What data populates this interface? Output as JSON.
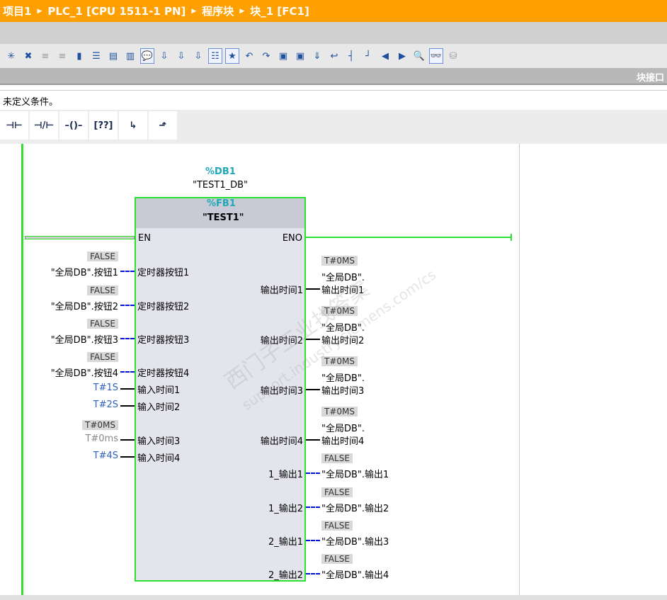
{
  "breadcrumb": [
    "项目1",
    "PLC_1 [CPU 1511-1 PN]",
    "程序块",
    "块_1 [FC1]"
  ],
  "toolbar_icons": [
    "insert-network-icon",
    "delete-network-icon",
    "insert-row-icon",
    "add-row-icon",
    "block-absolute-icon",
    "network-list-icon",
    "open-all-icon",
    "close-all-icon",
    "comment-icon",
    "favorites-download-icon",
    "instruction-download-icon",
    "network-download-icon",
    "list-icon",
    "favorites-icon",
    "go-to-error-icon",
    "next-error-icon",
    "monitor-icon",
    "monitor-block-icon",
    "compile-icon",
    "jump-icon",
    "branch-icon",
    "close-branch-icon",
    "previous-icon",
    "next-icon",
    "search-icon",
    "monitoring-on-icon",
    "database-icon"
  ],
  "interface_label": "块接口",
  "condition_text": "未定义条件。",
  "lad_buttons": [
    {
      "icon": "normally-open-contact-icon",
      "glyph": "⊣⊢"
    },
    {
      "icon": "normally-closed-contact-icon",
      "glyph": "⊣/⊢"
    },
    {
      "icon": "coil-icon",
      "glyph": "–()–"
    },
    {
      "icon": "empty-box-icon",
      "glyph": "[??]"
    },
    {
      "icon": "open-branch-icon",
      "glyph": "↳"
    },
    {
      "icon": "close-branch-icon",
      "glyph": "⬏"
    }
  ],
  "block": {
    "db_address": "%DB1",
    "db_name": "\"TEST1_DB\"",
    "fb_address": "%FB1",
    "fb_name": "\"TEST1\"",
    "en": "EN",
    "eno": "ENO"
  },
  "inputs": [
    {
      "pin": "定时器按钮1",
      "value": "\"全局DB\".按钮1",
      "status": "FALSE",
      "wire": "dash",
      "style": "black"
    },
    {
      "pin": "定时器按钮2",
      "value": "\"全局DB\".按钮2",
      "status": "FALSE",
      "wire": "dash",
      "style": "black"
    },
    {
      "pin": "定时器按钮3",
      "value": "\"全局DB\".按钮3",
      "status": "FALSE",
      "wire": "dash",
      "style": "black"
    },
    {
      "pin": "定时器按钮4",
      "value": "\"全局DB\".按钮4",
      "status": "FALSE",
      "wire": "dash",
      "style": "black"
    },
    {
      "pin": "输入时间1",
      "value": "T#1S",
      "status": "",
      "wire": "solid",
      "style": "blue"
    },
    {
      "pin": "输入时间2",
      "value": "T#2S",
      "status": "",
      "wire": "solid",
      "style": "blue"
    },
    {
      "pin": "输入时间3",
      "value": "T#0ms",
      "status": "T#0MS",
      "wire": "solid",
      "style": "lgray"
    },
    {
      "pin": "输入时间4",
      "value": "T#4S",
      "status": "",
      "wire": "solid",
      "style": "blue"
    }
  ],
  "outputs": [
    {
      "pin": "输出时间1",
      "value_line1": "\"全局DB\".",
      "value_line2": "输出时间1",
      "status": "T#0MS",
      "wire": "solid"
    },
    {
      "pin": "输出时间2",
      "value_line1": "\"全局DB\".",
      "value_line2": "输出时间2",
      "status": "T#0MS",
      "wire": "solid"
    },
    {
      "pin": "输出时间3",
      "value_line1": "\"全局DB\".",
      "value_line2": "输出时间3",
      "status": "T#0MS",
      "wire": "solid"
    },
    {
      "pin": "输出时间4",
      "value_line1": "\"全局DB\".",
      "value_line2": "输出时间4",
      "status": "T#0MS",
      "wire": "solid"
    },
    {
      "pin": "1_输出1",
      "value_line1": "\"全局DB\".输出1",
      "value_line2": "",
      "status": "FALSE",
      "wire": "dash"
    },
    {
      "pin": "1_输出2",
      "value_line1": "\"全局DB\".输出2",
      "value_line2": "",
      "status": "FALSE",
      "wire": "dash"
    },
    {
      "pin": "2_输出1",
      "value_line1": "\"全局DB\".输出3",
      "value_line2": "",
      "status": "FALSE",
      "wire": "dash"
    },
    {
      "pin": "2_输出2",
      "value_line1": "\"全局DB\".输出4",
      "value_line2": "",
      "status": "FALSE",
      "wire": "dash"
    }
  ],
  "watermark": "西门子工业找答案 support.industry.siemens.com/cs",
  "colors": {
    "title_bar": "#ffa000",
    "power_flow": "#30e030",
    "db_address": "#20a8b8",
    "bool_wire": "#0010e0"
  }
}
